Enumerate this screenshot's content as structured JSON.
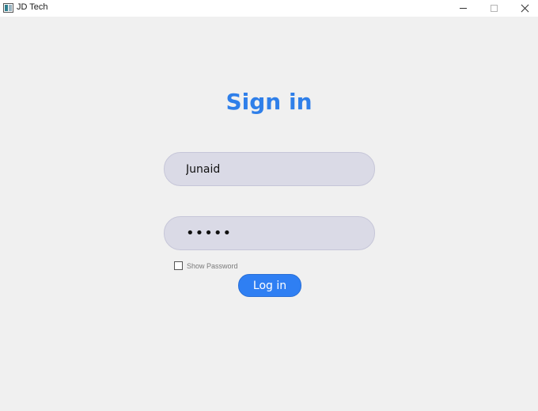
{
  "window": {
    "title": "JD Tech",
    "controls": {
      "minimize_icon": "minimize-icon",
      "maximize_icon": "maximize-icon",
      "close_icon": "close-icon"
    }
  },
  "form": {
    "heading": "Sign in",
    "username_value": "Junaid",
    "password_mask": "•••••",
    "show_password_label": "Show Password",
    "show_password_checked": false,
    "login_label": "Log in"
  },
  "colors": {
    "accent": "#2f7fe9",
    "button": "#2f7ff3",
    "field_bg": "#dadae6",
    "window_bg": "#f0f0f0"
  }
}
